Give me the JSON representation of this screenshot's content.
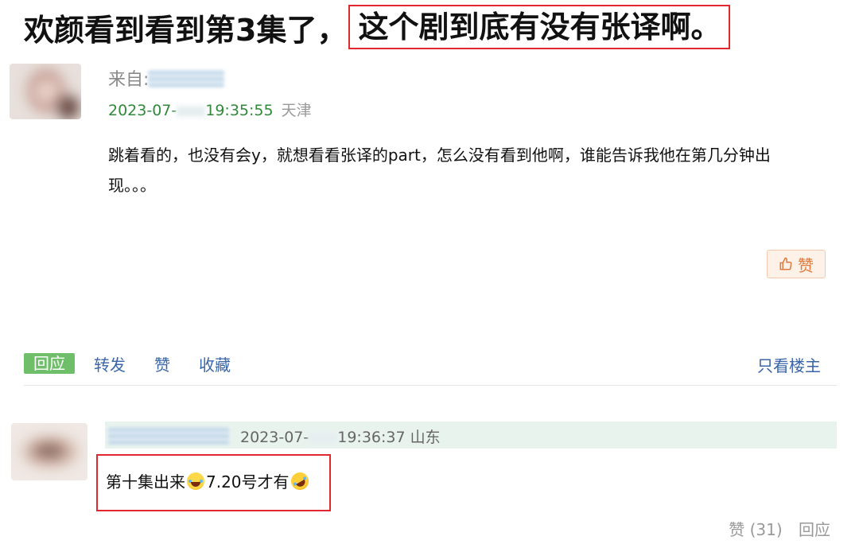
{
  "post": {
    "title_plain": "欢颜看到看到第3集了，",
    "title_highlight": "这个剧到底有没有张译啊。",
    "from_label": "来自:",
    "date_prefix": "2023-07-",
    "time": "19:35:55",
    "location": "天津",
    "body": "跳着看的，也没有会y，就想看看张译的part，怎么没有看到他啊，谁能告诉我他在第几分钟出现。。。",
    "like_label": "赞"
  },
  "actions": {
    "reply": "回应",
    "forward": "转发",
    "like": "赞",
    "collect": "收藏",
    "only_op": "只看楼主"
  },
  "reply": {
    "date_prefix": "2023-07-",
    "time": "19:36:37",
    "location": "山东",
    "text_1": "第十集出来",
    "emoji_1": "face-with-tears-of-joy-icon",
    "text_2": "7.20号才有",
    "emoji_2": "rolling-on-floor-laughing-icon",
    "like_label": "赞 (31)",
    "reply_label": "回应"
  },
  "colors": {
    "highlight_border": "#e0282e",
    "date_green": "#2f8a3a",
    "link_blue": "#3a66a8",
    "reply_button_bg": "#6fbf6a",
    "like_button_text": "#e07a3c"
  }
}
